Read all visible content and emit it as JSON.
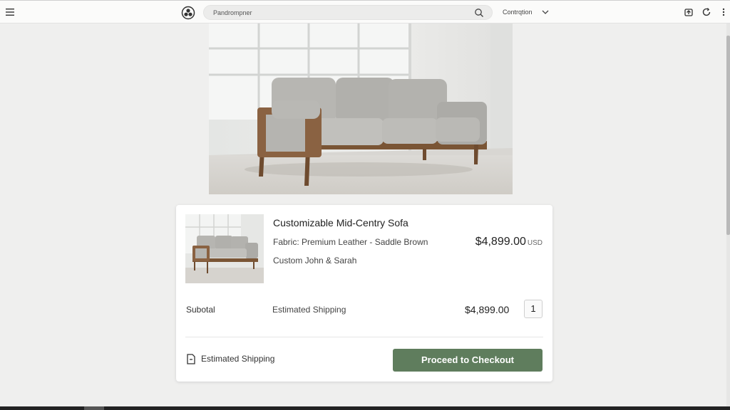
{
  "topbar": {
    "search": {
      "value": "",
      "placeholder": "Pandrompner"
    },
    "location_label": "Contrqtion",
    "icons": [
      "menu-icon",
      "logo-icon",
      "search-icon",
      "chevron-down-icon",
      "upload-icon",
      "refresh-icon",
      "more-vertical-icon"
    ]
  },
  "product": {
    "title": "Customizable Mid-Centry Sofa",
    "fabric": "Fabric: Premium Leather - Saddle Brown",
    "custom": "Custom John & Sarah",
    "price": "$4,899.00",
    "currency": "USD"
  },
  "summary": {
    "subtotal_label": "Subotal",
    "shipping_label": "Estimated Shipping",
    "subtotal_price": "$4,899.00",
    "quantity": "1"
  },
  "footer": {
    "shipping_link": "Estimated Shipping",
    "checkout_label": "Proceed to Checkout"
  },
  "colors": {
    "accent": "#5f7d5d",
    "page_bg": "#efefee",
    "sofa_fabric": "#b8b7b3",
    "sofa_wood": "#7a5535"
  }
}
